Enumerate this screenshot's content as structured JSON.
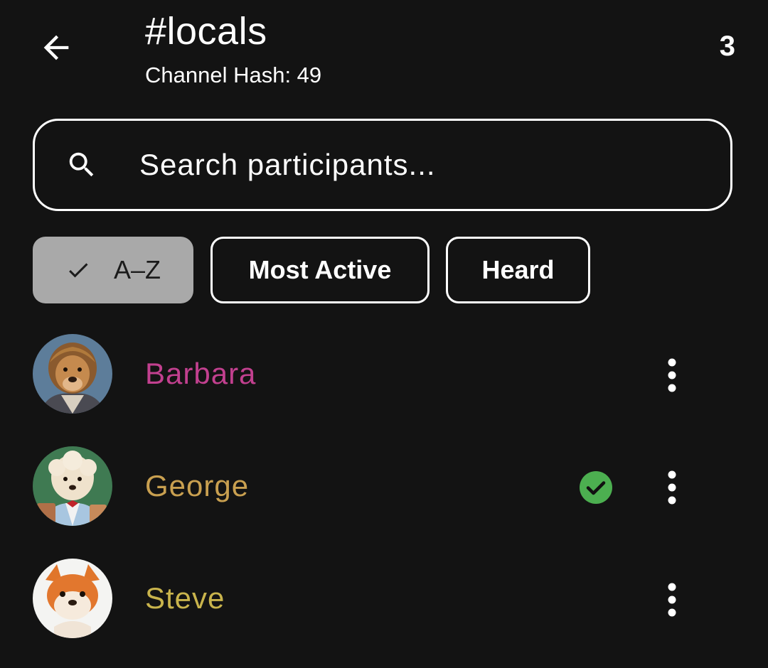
{
  "header": {
    "title": "#locals",
    "subtitle": "Channel Hash: 49",
    "count": "3"
  },
  "search": {
    "placeholder": "Search participants..."
  },
  "filters": [
    {
      "label": "A–Z",
      "selected": true
    },
    {
      "label": "Most Active",
      "selected": false
    },
    {
      "label": "Heard",
      "selected": false
    }
  ],
  "participants": [
    {
      "name": "Barbara",
      "color": "#c2408f",
      "verified": false
    },
    {
      "name": "George",
      "color": "#c9a050",
      "verified": true
    },
    {
      "name": "Steve",
      "color": "#c9b44c",
      "verified": false
    }
  ],
  "icons": {
    "back": "arrow-left-icon",
    "search": "search-icon",
    "check": "check-icon",
    "verified": "check-circle-icon",
    "more": "more-vert-icon"
  },
  "colors": {
    "background": "#131313",
    "chip_selected_bg": "#a9a9a9",
    "verified_green": "#4caf50"
  }
}
